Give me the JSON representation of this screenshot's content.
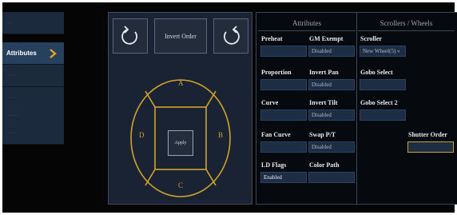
{
  "sidebar": {
    "items": [
      {
        "label": "···",
        "blurred": true
      },
      {
        "label": "Attributes",
        "blurred": false,
        "active": true
      },
      {
        "label": "·····",
        "blurred": true
      },
      {
        "label": "·····",
        "blurred": true
      },
      {
        "label": "······",
        "blurred": true
      },
      {
        "label": "·····",
        "blurred": true
      }
    ]
  },
  "controls": {
    "invert_order_label": "Invert Order",
    "apply_label": "Apply",
    "pad_labels": {
      "top": "A",
      "right": "B",
      "bottom": "C",
      "left": "D"
    }
  },
  "attributes": {
    "header": "Attributes",
    "fields": [
      {
        "label": "Preheat",
        "value": ""
      },
      {
        "label": "GM Exempt",
        "value": "Disabled"
      },
      {
        "label": "Proportion",
        "value": ""
      },
      {
        "label": "Invert Pan",
        "value": "Disabled"
      },
      {
        "label": "Curve",
        "value": ""
      },
      {
        "label": "Invert Tilt",
        "value": "Disabled"
      },
      {
        "label": "Fan Curve",
        "value": ""
      },
      {
        "label": "Swap P/T",
        "value": "Disabled"
      },
      {
        "label": "LD Flags",
        "value": "Enabled"
      },
      {
        "label": "Color Path",
        "value": ""
      }
    ]
  },
  "scrollers": {
    "header": "Scrollers / Wheels",
    "scroller_label": "Scroller",
    "scroller_value": "New Wheel(5) »",
    "gobo_select_label": "Gobo Select",
    "gobo_select_value": "",
    "gobo_select_2_label": "Gobo Select 2",
    "gobo_select_2_value": "",
    "shutter_order_label": "Shutter Order",
    "shutter_order_value": ""
  },
  "colors": {
    "accent_gold": "#d0a32a",
    "panel_bg": "#1a2333",
    "field_bg": "#1d2d44"
  }
}
